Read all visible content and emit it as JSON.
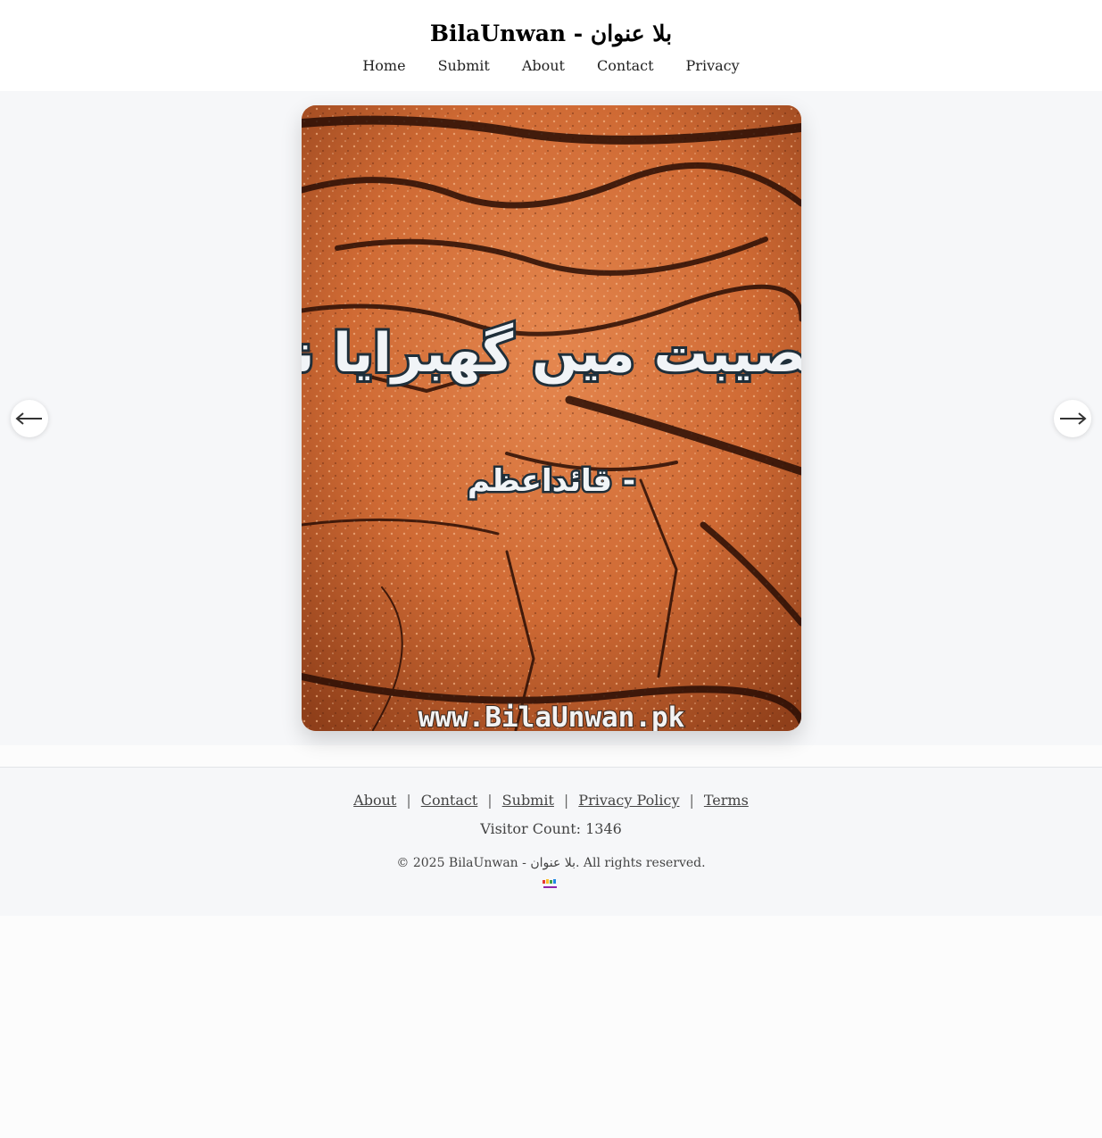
{
  "header": {
    "title": "BilaUnwan - بلا عنوان",
    "nav": [
      {
        "label": "Home"
      },
      {
        "label": "Submit"
      },
      {
        "label": "About"
      },
      {
        "label": "Contact"
      },
      {
        "label": "Privacy"
      }
    ]
  },
  "slide": {
    "quote_text": "مصیبت میں گھبرایا نہ",
    "attribution": "- قائداعظم",
    "watermark": "www.BilaUnwan.pk",
    "background_color": "#cf6a34",
    "text_stroke_color": "#1f2f3a"
  },
  "controls": {
    "prev_icon": "arrow-left-icon",
    "next_icon": "arrow-right-icon"
  },
  "footer": {
    "links": [
      {
        "label": "About"
      },
      {
        "label": "Contact"
      },
      {
        "label": "Submit"
      },
      {
        "label": "Privacy Policy"
      },
      {
        "label": "Terms"
      }
    ],
    "separator": "|",
    "visitor_count": "Visitor Count: 1346",
    "copyright": "© 2025 BilaUnwan - بلا عنوان. All rights reserved.",
    "logo_icon": "site-logo-icon"
  }
}
